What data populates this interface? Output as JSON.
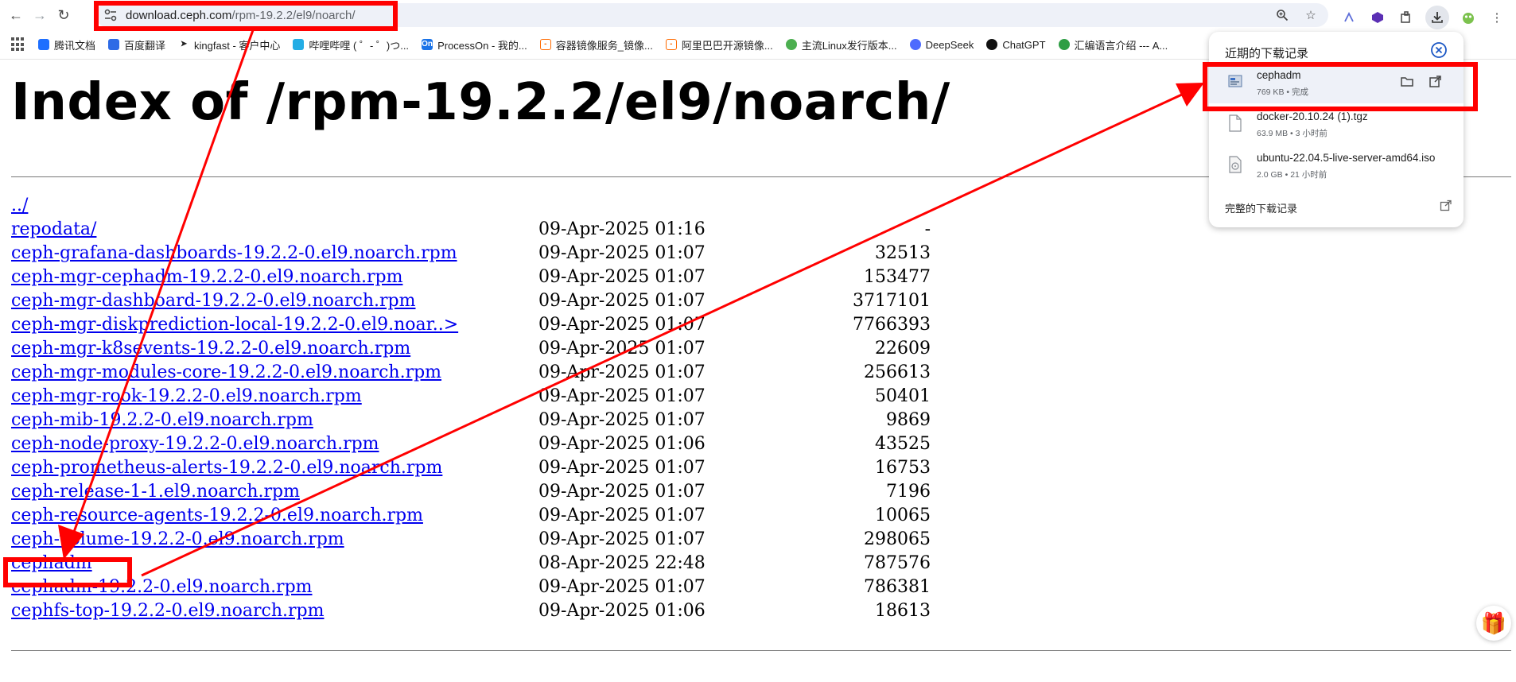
{
  "browser": {
    "url_host": "download.ceph.com",
    "url_path": "/rpm-19.2.2/el9/noarch/"
  },
  "bookmarks": [
    {
      "label": "腾讯文档",
      "color": "#1e6fff"
    },
    {
      "label": "百度翻译",
      "color": "#2e6be6"
    },
    {
      "label": "kingfast - 客户中心",
      "color": "#222222"
    },
    {
      "label": "哔哩哔哩 ( ゜- ゜)つ...",
      "color": "#23ade5"
    },
    {
      "label": "ProcessOn - 我的...",
      "color": "#1a73e8"
    },
    {
      "label": "容器镜像服务_镜像...",
      "color": "#ff6a00"
    },
    {
      "label": "阿里巴巴开源镜像...",
      "color": "#ff6a00"
    },
    {
      "label": "主流Linux发行版本...",
      "color": "#4caf50"
    },
    {
      "label": "DeepSeek",
      "color": "#4d6bfe"
    },
    {
      "label": "ChatGPT",
      "color": "#111111"
    },
    {
      "label": "汇编语言介绍 --- A...",
      "color": "#2e9e44"
    }
  ],
  "page": {
    "heading": "Index of /rpm-19.2.2/el9/noarch/",
    "parent_link": "../",
    "rows": [
      {
        "name": "repodata/",
        "date": "09-Apr-2025 01:16",
        "size": "-"
      },
      {
        "name": "ceph-grafana-dashboards-19.2.2-0.el9.noarch.rpm",
        "date": "09-Apr-2025 01:07",
        "size": "32513"
      },
      {
        "name": "ceph-mgr-cephadm-19.2.2-0.el9.noarch.rpm",
        "date": "09-Apr-2025 01:07",
        "size": "153477"
      },
      {
        "name": "ceph-mgr-dashboard-19.2.2-0.el9.noarch.rpm",
        "date": "09-Apr-2025 01:07",
        "size": "3717101"
      },
      {
        "name": "ceph-mgr-diskprediction-local-19.2.2-0.el9.noar..>",
        "date": "09-Apr-2025 01:07",
        "size": "7766393"
      },
      {
        "name": "ceph-mgr-k8sevents-19.2.2-0.el9.noarch.rpm",
        "date": "09-Apr-2025 01:07",
        "size": "22609"
      },
      {
        "name": "ceph-mgr-modules-core-19.2.2-0.el9.noarch.rpm",
        "date": "09-Apr-2025 01:07",
        "size": "256613"
      },
      {
        "name": "ceph-mgr-rook-19.2.2-0.el9.noarch.rpm",
        "date": "09-Apr-2025 01:07",
        "size": "50401"
      },
      {
        "name": "ceph-mib-19.2.2-0.el9.noarch.rpm",
        "date": "09-Apr-2025 01:07",
        "size": "9869"
      },
      {
        "name": "ceph-node-proxy-19.2.2-0.el9.noarch.rpm",
        "date": "09-Apr-2025 01:06",
        "size": "43525"
      },
      {
        "name": "ceph-prometheus-alerts-19.2.2-0.el9.noarch.rpm",
        "date": "09-Apr-2025 01:07",
        "size": "16753"
      },
      {
        "name": "ceph-release-1-1.el9.noarch.rpm",
        "date": "09-Apr-2025 01:07",
        "size": "7196"
      },
      {
        "name": "ceph-resource-agents-19.2.2-0.el9.noarch.rpm",
        "date": "09-Apr-2025 01:07",
        "size": "10065"
      },
      {
        "name": "ceph-volume-19.2.2-0.el9.noarch.rpm",
        "date": "09-Apr-2025 01:07",
        "size": "298065"
      },
      {
        "name": "cephadm",
        "date": "08-Apr-2025 22:48",
        "size": "787576"
      },
      {
        "name": "cephadm-19.2.2-0.el9.noarch.rpm",
        "date": "09-Apr-2025 01:07",
        "size": "786381"
      },
      {
        "name": "cephfs-top-19.2.2-0.el9.noarch.rpm",
        "date": "09-Apr-2025 01:06",
        "size": "18613"
      }
    ]
  },
  "downloads": {
    "title": "近期的下载记录",
    "items": [
      {
        "name": "cephadm",
        "meta": "769 KB • 完成"
      },
      {
        "name": "docker-20.10.24 (1).tgz",
        "meta": "63.9 MB • 3 小时前"
      },
      {
        "name": "ubuntu-22.04.5-live-server-amd64.iso",
        "meta": "2.0 GB • 21 小时前"
      }
    ],
    "full_history": "完整的下载记录"
  },
  "colors": {
    "link": "#0000ee",
    "annotation": "#ff0000",
    "omnibox_bg": "#eef1f8"
  }
}
